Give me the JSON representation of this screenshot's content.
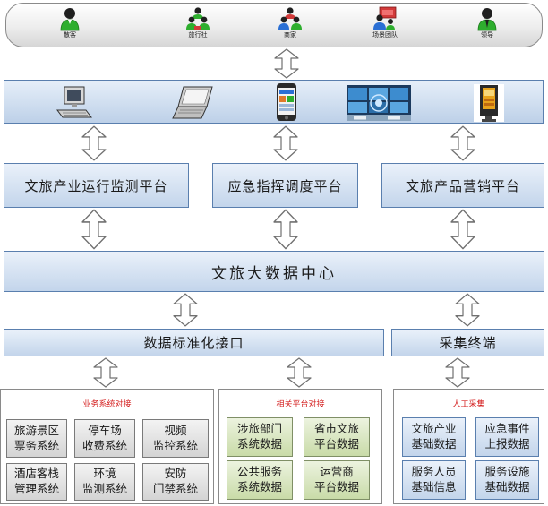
{
  "users": [
    {
      "label": "散客",
      "icon": "single-person-icon"
    },
    {
      "label": "旅行社",
      "icon": "group-icon"
    },
    {
      "label": "商家",
      "icon": "merchant-icon"
    },
    {
      "label": "场景团队",
      "icon": "team-board-icon"
    },
    {
      "label": "领导",
      "icon": "leader-icon"
    }
  ],
  "devices": [
    "desktop-pc-icon",
    "laptop-icon",
    "smartphone-icon",
    "video-wall-icon",
    "kiosk-icon"
  ],
  "platforms": {
    "monitoring": "文旅产业运行监测平台",
    "emergency": "应急指挥调度平台",
    "marketing": "文旅产品营销平台"
  },
  "data_center": "文旅大数据中心",
  "interface": "数据标准化接口",
  "terminal": "采集终端",
  "panels": {
    "business": {
      "title": "业务系统对接",
      "cells": [
        "旅游景区\n票务系统",
        "停车场\n收费系统",
        "视频\n监控系统",
        "酒店客栈\n管理系统",
        "环境\n监测系统",
        "安防\n门禁系统"
      ]
    },
    "related": {
      "title": "相关平台对接",
      "cells": [
        "涉旅部门\n系统数据",
        "省市文旅\n平台数据",
        "公共服务\n系统数据",
        "运营商\n平台数据"
      ]
    },
    "manual": {
      "title": "人工采集",
      "cells": [
        "文旅产业\n基础数据",
        "应急事件\n上报数据",
        "服务人员\n基础信息",
        "服务设施\n基础数据"
      ]
    }
  },
  "colors": {
    "box_fill": "#c3d5eb",
    "box_border": "#5a7fae",
    "panel_title": "#d42020",
    "green_cell": "#c9dba8",
    "gray_cell": "#d4d4d4"
  }
}
